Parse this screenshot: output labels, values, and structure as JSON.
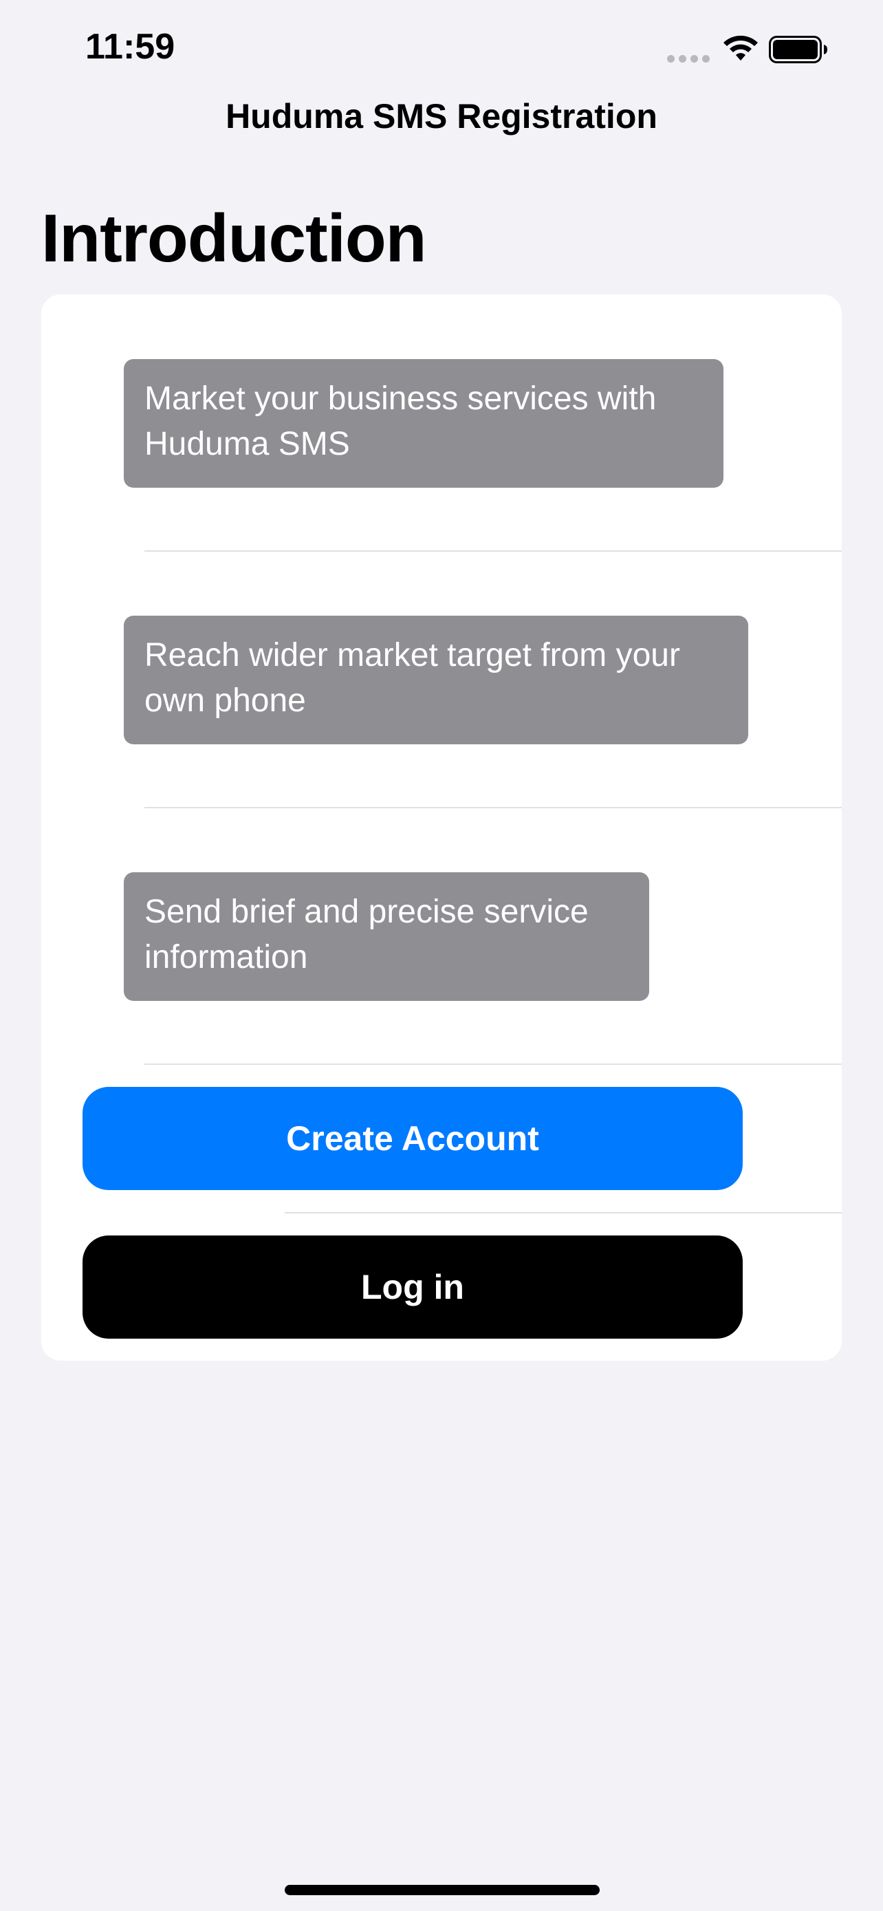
{
  "status_bar": {
    "time": "11:59"
  },
  "nav": {
    "title": "Huduma SMS Registration"
  },
  "page": {
    "large_title": "Introduction"
  },
  "intro_items": [
    {
      "text": "Market your business services with Huduma SMS"
    },
    {
      "text": "Reach wider market target from your own phone"
    },
    {
      "text": "Send brief and precise service information"
    }
  ],
  "actions": {
    "create_account_label": "Create Account",
    "log_in_label": "Log in"
  },
  "colors": {
    "background": "#f2f2f7",
    "card": "#ffffff",
    "bubble": "#8e8e93",
    "primary": "#007aff",
    "dark_button": "#000000"
  },
  "icons": {
    "signal": "cellular-signal-icon",
    "wifi": "wifi-icon",
    "battery": "battery-icon"
  }
}
